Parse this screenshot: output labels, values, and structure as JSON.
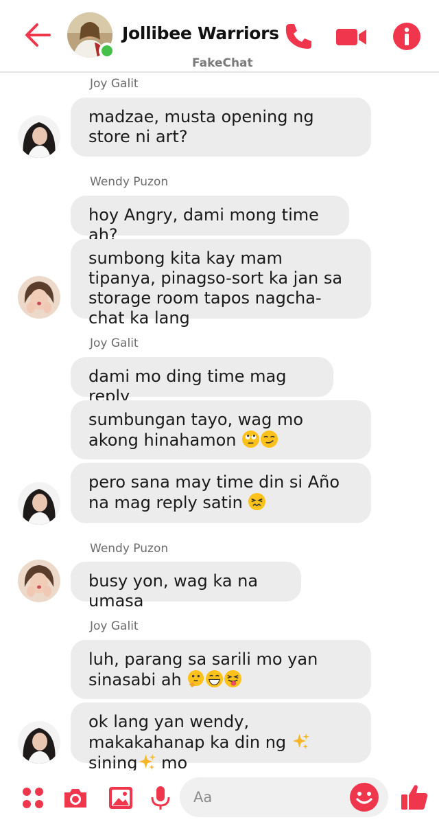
{
  "header": {
    "title": "Jollibee Warriors",
    "watermark": "FakeChat"
  },
  "accent_color": "#f0364c",
  "messages": [
    {
      "sender": "Joy Galit",
      "bubbles": [
        "madzae, musta opening ng store ni art?"
      ]
    },
    {
      "sender": "Wendy Puzon",
      "bubbles": [
        "hoy Angry, dami mong time ah?",
        "sumbong kita kay mam tipanya, pinagso-sort ka jan sa storage room tapos nagcha-chat ka lang"
      ]
    },
    {
      "sender": "Joy Galit",
      "bubbles": [
        "dami mo ding time mag reply",
        "sumbungan tayo, wag mo akong hinahamon",
        "pero sana may time din si Año na mag reply satin"
      ]
    },
    {
      "sender": "Wendy Puzon",
      "bubbles": [
        "busy yon, wag ka na umasa"
      ]
    },
    {
      "sender": "Joy Galit",
      "bubbles": [
        "luh, parang sa sarili mo yan sinasabi ah",
        "ok lang yan wendy, makakahanap ka din ng",
        "sining",
        "mo"
      ]
    }
  ],
  "composer": {
    "placeholder": "Aa"
  },
  "icons": [
    "back-arrow",
    "phone",
    "video-camera",
    "info",
    "apps-grid",
    "camera",
    "gallery",
    "microphone",
    "emoji-smile",
    "thumbs-up"
  ]
}
